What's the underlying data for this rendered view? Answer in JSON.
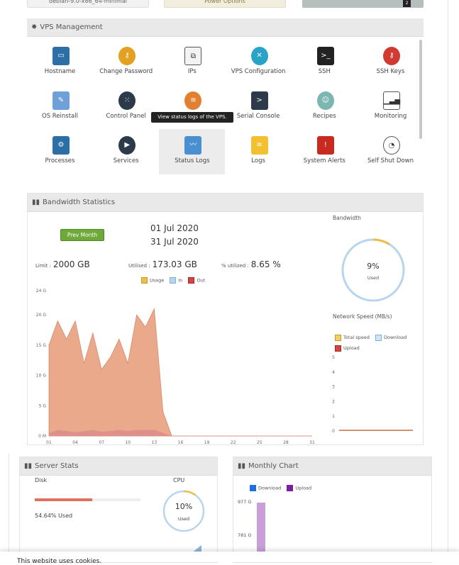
{
  "topbar": {
    "os_label": "debian-9.0-x86_64-minimal",
    "power_label": "Power Options",
    "badge": "2"
  },
  "vps": {
    "title": "VPS Management",
    "tooltip": "View status logs of the VPS.",
    "tiles": [
      {
        "label": "Hostname",
        "icon": "monitor-icon"
      },
      {
        "label": "Change Password",
        "icon": "key-icon"
      },
      {
        "label": "IPs",
        "icon": "network-icon"
      },
      {
        "label": "VPS Configuration",
        "icon": "wrench-icon"
      },
      {
        "label": "SSH",
        "icon": "terminal-icon"
      },
      {
        "label": "SSH Keys",
        "icon": "ssh-key-icon"
      },
      {
        "label": "OS Reinstall",
        "icon": "reinstall-icon"
      },
      {
        "label": "Control Panel",
        "icon": "control-panel-icon"
      },
      {
        "label": "",
        "icon": "rainbow-icon"
      },
      {
        "label": "Serial Console",
        "icon": "console-icon"
      },
      {
        "label": "Recipes",
        "icon": "chef-icon"
      },
      {
        "label": "Monitoring",
        "icon": "monitoring-icon"
      },
      {
        "label": "Processes",
        "icon": "processes-icon"
      },
      {
        "label": "Services",
        "icon": "services-icon"
      },
      {
        "label": "Status Logs",
        "icon": "status-logs-icon"
      },
      {
        "label": "Logs",
        "icon": "notepad-icon"
      },
      {
        "label": "System Alerts",
        "icon": "alert-icon"
      },
      {
        "label": "Self Shut Down",
        "icon": "timer-icon"
      }
    ]
  },
  "bandwidth": {
    "title": "Bandwidth Statistics",
    "prev_label": "Prev Month",
    "date_from": "01 Jul 2020",
    "date_to": "31 Jul 2020",
    "limit_label": "Limit :",
    "limit_value": "2000 GB",
    "used_label": "Utilised :",
    "used_value": "173.03 GB",
    "pct_label": "% utilized :",
    "pct_value": "8.65 %",
    "legend": {
      "usage": "Usage",
      "in": "In",
      "out": "Out"
    },
    "side_title": "Bandwidth",
    "gauge_value": "9%",
    "gauge_used": "Used",
    "gauge_fraction": 0.09,
    "net_title": "Network Speed (MB/s)",
    "net_legend": {
      "total": "Total speed",
      "download": "Download",
      "upload": "Upload"
    }
  },
  "server": {
    "title": "Server Stats",
    "disk_label": "Disk",
    "disk_used": "54.64% Used",
    "disk_fraction": 0.5464,
    "cpu_label": "CPU",
    "cpu_value": "10%",
    "cpu_used": "Used",
    "cpu_fraction": 0.1
  },
  "monthly": {
    "title": "Monthly Chart",
    "legend": {
      "download": "Download",
      "upload": "Upload"
    },
    "yticks": [
      "977 G",
      "781 G"
    ]
  },
  "footer": {
    "text": "This website uses cookies."
  },
  "colors": {
    "usage": "#e8c04a",
    "in": "#b7d5ee",
    "out": "#d04545",
    "area": "#e9a98a",
    "green": "#6ea93a",
    "purple": "#c7a0d8"
  },
  "chart_data": [
    {
      "type": "area",
      "xlabel": "",
      "ylabel": "",
      "x": [
        1,
        2,
        3,
        4,
        5,
        6,
        7,
        8,
        9,
        10,
        11,
        12,
        13,
        14,
        15,
        16,
        17,
        18,
        19,
        20,
        21,
        22,
        23,
        24,
        25,
        26,
        27,
        28,
        29,
        30,
        31
      ],
      "xticks": [
        "01",
        "04",
        "07",
        "10",
        "13",
        "16",
        "19",
        "22",
        "25",
        "28",
        "31"
      ],
      "yticks": [
        "0 M",
        "5 G",
        "10 G",
        "15 G",
        "20 G",
        "24 G"
      ],
      "ylim": [
        0,
        24
      ],
      "series": [
        {
          "name": "In",
          "values": [
            15,
            19,
            16,
            19,
            12,
            17,
            11,
            13,
            16,
            12,
            20,
            18,
            21,
            4,
            0,
            0,
            0,
            0,
            0,
            0,
            0,
            0,
            0,
            0,
            0,
            0,
            0,
            0,
            0,
            0,
            0
          ]
        },
        {
          "name": "Out",
          "values": [
            0.5,
            1,
            0.8,
            0.6,
            0.8,
            1,
            0.7,
            0.8,
            1,
            0.8,
            1,
            1,
            1,
            0.5,
            0,
            0,
            0,
            0,
            0,
            0,
            0,
            0,
            0,
            0,
            0,
            0,
            0,
            0,
            0,
            0,
            0
          ]
        }
      ]
    },
    {
      "type": "line",
      "yticks": [
        "0",
        "1",
        "2",
        "3",
        "4",
        "5"
      ],
      "ylim": [
        0,
        5
      ],
      "series": [
        {
          "name": "Total speed",
          "values": [
            0.02,
            0.02,
            0.02,
            0.02,
            0.02
          ]
        },
        {
          "name": "Upload",
          "values": [
            0.02,
            0.02,
            0.02,
            0.02,
            0.02
          ]
        }
      ]
    }
  ]
}
